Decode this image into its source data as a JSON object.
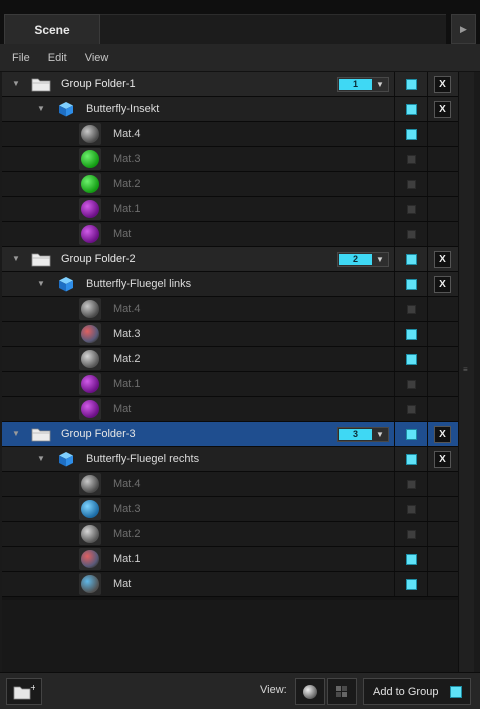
{
  "panel": {
    "tab_label": "Scene",
    "collapse_glyph": "▶"
  },
  "menu": [
    "File",
    "Edit",
    "View"
  ],
  "tree": {
    "groups": [
      {
        "label": "Group Folder-1",
        "layer": "1",
        "selected": false,
        "object": {
          "label": "Butterfly-Insekt"
        },
        "materials": [
          {
            "label": "Mat.4",
            "enabled": true,
            "thumb": "gray-noise"
          },
          {
            "label": "Mat.3",
            "enabled": false,
            "thumb": "green"
          },
          {
            "label": "Mat.2",
            "enabled": false,
            "thumb": "green"
          },
          {
            "label": "Mat.1",
            "enabled": false,
            "thumb": "purple"
          },
          {
            "label": "Mat",
            "enabled": false,
            "thumb": "purple"
          }
        ]
      },
      {
        "label": "Group Folder-2",
        "layer": "2",
        "selected": false,
        "object": {
          "label": "Butterfly-Fluegel links"
        },
        "materials": [
          {
            "label": "Mat.4",
            "enabled": false,
            "thumb": "gray-noise"
          },
          {
            "label": "Mat.3",
            "enabled": true,
            "thumb": "gray-red"
          },
          {
            "label": "Mat.2",
            "enabled": true,
            "thumb": "gray"
          },
          {
            "label": "Mat.1",
            "enabled": false,
            "thumb": "purple"
          },
          {
            "label": "Mat",
            "enabled": false,
            "thumb": "purple"
          }
        ]
      },
      {
        "label": "Group Folder-3",
        "layer": "3",
        "selected": true,
        "object": {
          "label": "Butterfly-Fluegel rechts"
        },
        "materials": [
          {
            "label": "Mat.4",
            "enabled": false,
            "thumb": "gray-noise"
          },
          {
            "label": "Mat.3",
            "enabled": false,
            "thumb": "blue"
          },
          {
            "label": "Mat.2",
            "enabled": false,
            "thumb": "gray"
          },
          {
            "label": "Mat.1",
            "enabled": true,
            "thumb": "gray-red"
          },
          {
            "label": "Mat",
            "enabled": true,
            "thumb": "gray-blue"
          }
        ]
      }
    ]
  },
  "bottom": {
    "view_label": "View:",
    "add_to_group_label": "Add to Group"
  },
  "colors": {
    "accent": "#3fd8f4",
    "selection": "#1f4e8f",
    "visibility_on": "#5fe3f8"
  }
}
